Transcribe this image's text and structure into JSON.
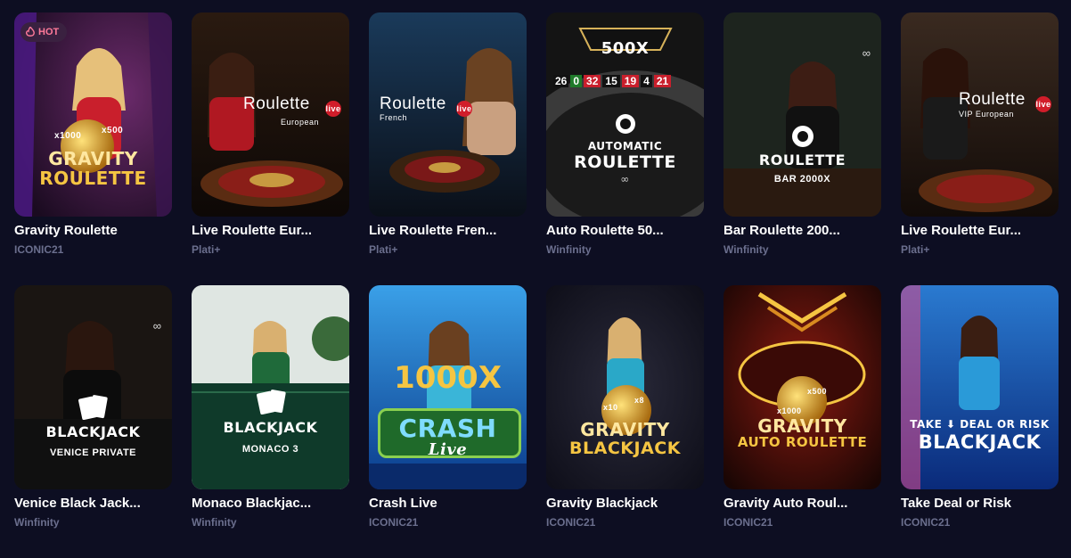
{
  "games": [
    {
      "title": "Gravity Roulette",
      "provider": "ICONIC21",
      "badge": "HOT",
      "logo": "GRAVITY",
      "logo2": "ROULETTE",
      "chips": [
        "x1000",
        "x500"
      ]
    },
    {
      "title": "Live Roulette Eur...",
      "provider": "Plati+",
      "logo": "Roulette",
      "live": "live",
      "sub": "European"
    },
    {
      "title": "Live Roulette Fren...",
      "provider": "Plati+",
      "logo": "Roulette",
      "live": "live",
      "sub": "French"
    },
    {
      "title": "Auto Roulette 50...",
      "provider": "Winfinity",
      "top": "500X",
      "logo": "AUTOMATIC",
      "logo2": "ROULETTE",
      "wheel_numbers": [
        "26",
        "0",
        "32",
        "15",
        "19",
        "4",
        "21"
      ]
    },
    {
      "title": "Bar Roulette 200...",
      "provider": "Winfinity",
      "logo": "ROULETTE",
      "sub": "BAR 2000X"
    },
    {
      "title": "Live Roulette Eur...",
      "provider": "Plati+",
      "logo": "Roulette",
      "live": "live",
      "sub": "VIP European"
    },
    {
      "title": "Venice Black Jack...",
      "provider": "Winfinity",
      "logo": "BLACKJACK",
      "sub": "VENICE PRIVATE"
    },
    {
      "title": "Monaco Blackjac...",
      "provider": "Winfinity",
      "logo": "BLACKJACK",
      "sub": "MONACO 3"
    },
    {
      "title": "Crash Live",
      "provider": "ICONIC21",
      "top": "1000X",
      "logo": "CRASH",
      "logo2": "Live"
    },
    {
      "title": "Gravity Blackjack",
      "provider": "ICONIC21",
      "logo": "GRAVITY",
      "logo2": "BLACKJACK",
      "chips": [
        "x10",
        "x8"
      ]
    },
    {
      "title": "Gravity Auto Roul...",
      "provider": "ICONIC21",
      "logo": "GRAVITY",
      "logo2": "AUTO ROULETTE",
      "chips": [
        "x1000",
        "x500"
      ]
    },
    {
      "title": "Take Deal or Risk",
      "provider": "ICONIC21",
      "logo": "TAKE ⬇ DEAL OR RISK",
      "logo2": "BLACKJACK"
    }
  ],
  "colors": {
    "background": "#0d0e22",
    "provider_text": "#6b6f8e",
    "hot_badge_bg": "#3a2140",
    "hot_badge_text": "#ff7a9a",
    "gold": "#f5c542"
  }
}
